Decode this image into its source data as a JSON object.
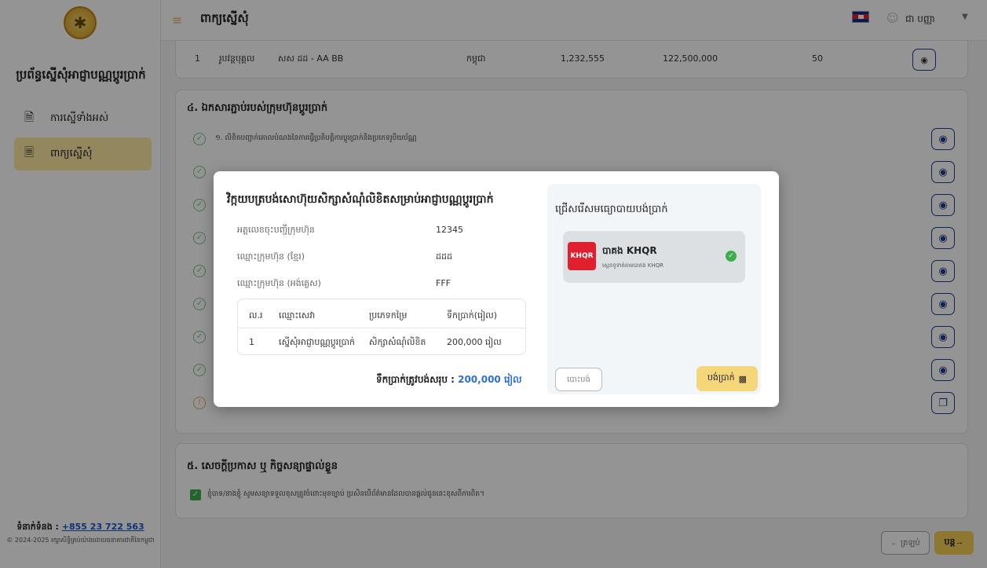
{
  "sidebar": {
    "system_title": "ប្រព័ន្ធស្នើសុំអាជ្ញាបណ្ណប្តូរប្រាក់",
    "items": [
      {
        "label": "ការស្នើទាំងអស់",
        "icon": "document-icon"
      },
      {
        "label": "ពាក្យស្នើសុំ",
        "icon": "document-add-icon"
      }
    ],
    "contact_label": "ទំនាក់ទំនង :",
    "contact_phone": "+855 23 722 563",
    "copyright": "© 2024-2025 រក្សាសិទ្ធិគ្រប់យ៉ាងដោយធនាគារជាតិនៃកម្ពុជា"
  },
  "header": {
    "title": "ពាក្យស្នើសុំ",
    "user_name": "ជា បញ្ញា"
  },
  "top_row": {
    "num": "1",
    "type": "រូបវន្តបុគ្គល",
    "name": "សស ដដ - AA BB",
    "nationality": "កម្ពុជា",
    "v1": "1,232,555",
    "v2": "122,500,000",
    "v3": "50"
  },
  "section4": {
    "title": "៤. ឯកសារភ្ជាប់របស់ក្រុមហ៊ុនប្តូរប្រាក់",
    "docs": [
      {
        "text": "១. លិខិតបញ្ជាក់គោលបំណងនៃការធ្វើប្រតិបត្តិការប្តូរប្រាក់និងប្រភេទរូបិយប័ណ្ណ",
        "status": "ok"
      }
    ]
  },
  "section5": {
    "title": "៥. សេចក្តីប្រកាស ឬ កិច្ចសន្យាផ្ទាល់ខ្លួន",
    "declaration": "ខ្ញុំបាទ/នាងខ្ញុំ សូមសន្យាទទួលខុសត្រូវចំពោះមុខច្បាប់ ប្រសិនបើព័ត៌មានដែលបានផ្តល់ជូននេះខុសពីការពិត។"
  },
  "footer": {
    "back_label": "← ត្រឡប់",
    "next_label": "បន្ត→"
  },
  "modal": {
    "title": "វិក្កយបត្របង់សោហ៊ុយសិក្សាសំណុំលិខិតសម្រាប់អាជ្ញាបណ្ណប្តូរប្រាក់",
    "info": [
      {
        "label": "អត្តលេខចុះបញ្ជីក្រុមហ៊ុន",
        "value": "12345"
      },
      {
        "label": "ឈ្មោះក្រុមហ៊ុន (ខ្មែរ)",
        "value": "ដដដ"
      },
      {
        "label": "ឈ្មោះក្រុមហ៊ុន (អង់គ្លេស)",
        "value": "FFF"
      }
    ],
    "table": {
      "headers": [
        "ល.រ",
        "ឈ្មោះសេវា",
        "ប្រភេទកម្រៃ",
        "ទឹកប្រាក់(រៀល)"
      ],
      "rows": [
        [
          "1",
          "ស្នើសុំអាជ្ញាបណ្ណប្តូរប្រាក់",
          "សិក្សាសំណុំលិខិត",
          "200,000 រៀល"
        ]
      ]
    },
    "total_label": "ទឹកប្រាក់ត្រូវបង់សរុប :",
    "total_value": "200,000 រៀល",
    "pay_title": "ជ្រើសរើសមធ្យោបាយបង់ប្រាក់",
    "pay_option_name": "បាគង KHQR",
    "pay_option_desc": "ស្កេនទូទាត់តាមបាគង KHQR",
    "pay_logo_text": "KHQR",
    "cancel_label": "បោះបង់",
    "pay_label": "បង់ប្រាក់"
  }
}
